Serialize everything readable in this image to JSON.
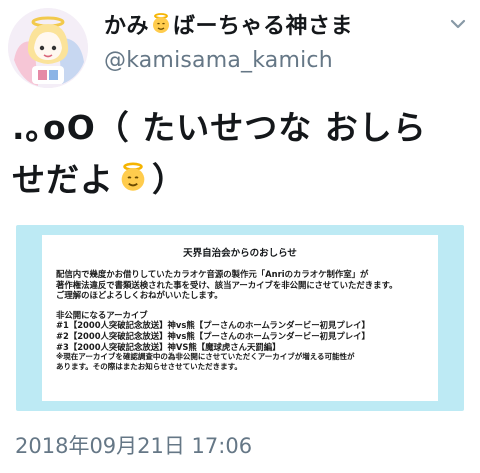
{
  "user": {
    "display_name_before": "かみ",
    "display_name_emoji": "angel-emoji",
    "display_name_after": "ばーちゃる神さま",
    "handle": "@kamisama_kamich"
  },
  "tweet": {
    "line1": ".｡oO（ たいせつな おしら",
    "line2_text": "せだよ",
    "line2_emoji": "angel-emoji",
    "line2_end": "）"
  },
  "notice": {
    "title": "天界自治会からのおしらせ",
    "paragraph": [
      "配信内で幾度かお借りしていたカラオケ音源の製作元「Anriのカラオケ制作室」が",
      "著作権法違反で書類送検された事を受け、該当アーカイブを非公開にさせていただきます。",
      "ご理解のほどよろしくおねがいいたします。"
    ],
    "list_heading": "非公開になるアーカイブ",
    "list_items": [
      "#1【2000人突破記念放送】神vs熊【プーさんのホームランダービー初見プレイ】",
      "#2【2000人突破記念放送】神vs熊【プーさんのホームランダービー初見プレイ】",
      "#3【2000人突破記念放送】神VS熊【魔球虎さん天罰編】"
    ],
    "footnote": [
      "※現在アーカイブを確認調査中の為非公開にさせていただくアーカイブが増える可能性が",
      "あります。その際はまたお知らせさせていただきます。"
    ]
  },
  "timestamp": "2018年09月21日 17:06",
  "colors": {
    "card_background": "#bdeaf4",
    "secondary_text": "#657786",
    "primary_text": "#14171a"
  }
}
